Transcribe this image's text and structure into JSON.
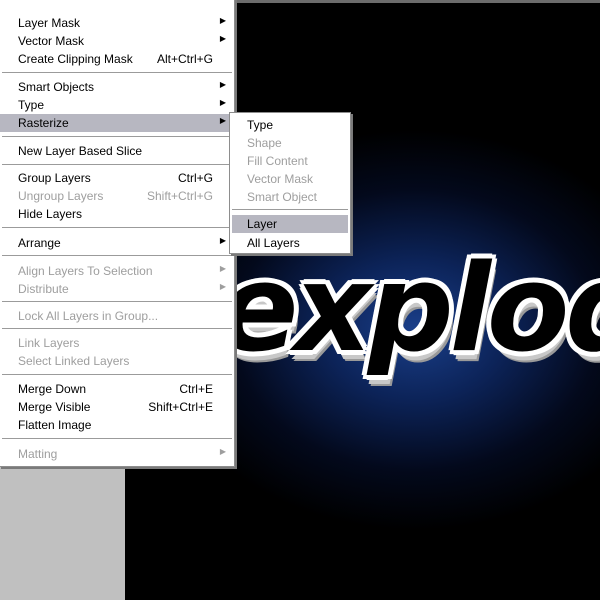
{
  "main_menu": {
    "items": [
      {
        "label": "Layer Mask",
        "shortcut": "",
        "arrow": "▶"
      },
      {
        "label": "Vector Mask",
        "shortcut": "",
        "arrow": "▶"
      },
      {
        "label": "Create Clipping Mask",
        "shortcut": "Alt+Ctrl+G",
        "arrow": ""
      },
      {
        "label": "Smart Objects",
        "shortcut": "",
        "arrow": "▶"
      },
      {
        "label": "Type",
        "shortcut": "",
        "arrow": "▶"
      },
      {
        "label": "Rasterize",
        "shortcut": "",
        "arrow": "▶"
      },
      {
        "label": "New Layer Based Slice",
        "shortcut": "",
        "arrow": ""
      },
      {
        "label": "Group Layers",
        "shortcut": "Ctrl+G",
        "arrow": ""
      },
      {
        "label": "Ungroup Layers",
        "shortcut": "Shift+Ctrl+G",
        "arrow": ""
      },
      {
        "label": "Hide Layers",
        "shortcut": "",
        "arrow": ""
      },
      {
        "label": "Arrange",
        "shortcut": "",
        "arrow": "▶"
      },
      {
        "label": "Align Layers To Selection",
        "shortcut": "",
        "arrow": "▶"
      },
      {
        "label": "Distribute",
        "shortcut": "",
        "arrow": "▶"
      },
      {
        "label": "Lock All Layers in Group...",
        "shortcut": "",
        "arrow": ""
      },
      {
        "label": "Link Layers",
        "shortcut": "",
        "arrow": ""
      },
      {
        "label": "Select Linked Layers",
        "shortcut": "",
        "arrow": ""
      },
      {
        "label": "Merge Down",
        "shortcut": "Ctrl+E",
        "arrow": ""
      },
      {
        "label": "Merge Visible",
        "shortcut": "Shift+Ctrl+E",
        "arrow": ""
      },
      {
        "label": "Flatten Image",
        "shortcut": "",
        "arrow": ""
      },
      {
        "label": "Matting",
        "shortcut": "",
        "arrow": "▶"
      }
    ]
  },
  "rasterize_submenu": {
    "items": [
      {
        "label": "Type"
      },
      {
        "label": "Shape"
      },
      {
        "label": "Fill Content"
      },
      {
        "label": "Vector Mask"
      },
      {
        "label": "Smart Object"
      },
      {
        "label": "Layer"
      },
      {
        "label": "All Layers"
      }
    ]
  },
  "canvas": {
    "text": "explod"
  },
  "colors": {
    "menu_bg": "#ffffff",
    "highlight": "#b7b7c1",
    "disabled_text": "#9e9e9e",
    "canvas_glow": "#1a3f8a"
  }
}
